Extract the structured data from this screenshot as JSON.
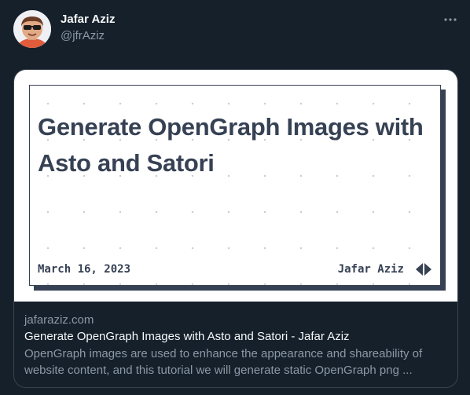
{
  "author": {
    "name": "Jafar Aziz",
    "handle": "@jfrAziz"
  },
  "card": {
    "image": {
      "title": "Generate OpenGraph Images with Asto and Satori",
      "date": "March 16, 2023",
      "author": "Jafar Aziz"
    },
    "domain": "jafaraziz.com",
    "title": "Generate OpenGraph Images with Asto and Satori - Jafar Aziz",
    "description": "OpenGraph images are used to enhance the appearance and shareability of website content, and this tutorial we will generate static OpenGraph png ..."
  },
  "colors": {
    "background": "#15202b",
    "card_border": "#38444d",
    "og_ink": "#364154"
  },
  "icons": {
    "more": "more-horizontal-icon",
    "logo": "site-logo-icon"
  }
}
